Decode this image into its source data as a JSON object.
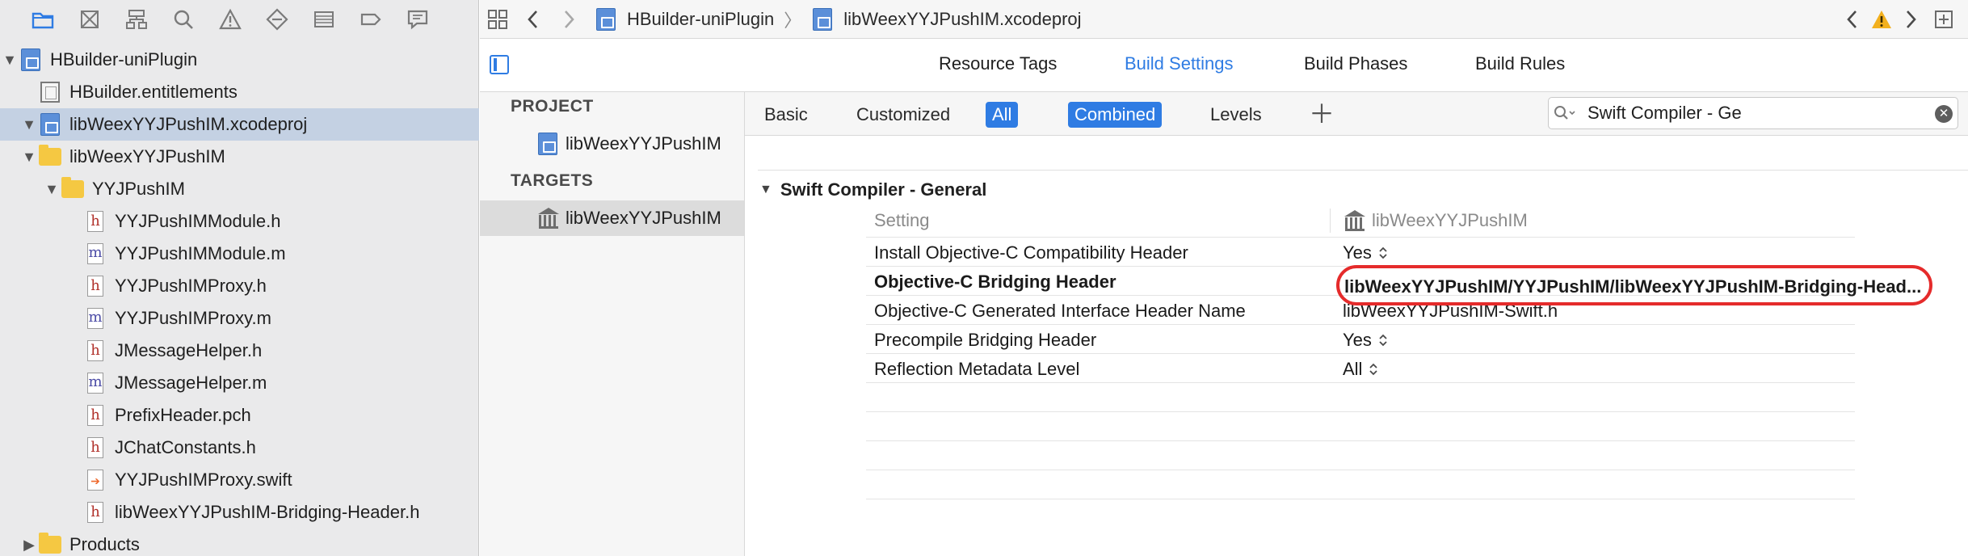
{
  "navigator": {
    "toolbar_icons": [
      "folder-icon",
      "source-control-icon",
      "hierarchy-icon",
      "search-icon",
      "warning-icon",
      "test-icon",
      "debug-icon",
      "breakpoint-icon",
      "report-icon"
    ],
    "tree": [
      {
        "label": "HBuilder-uniPlugin",
        "icon": "project-icon",
        "depth": 0,
        "disclosure": "▼"
      },
      {
        "label": "HBuilder.entitlements",
        "icon": "entitlements-icon",
        "depth": 1,
        "disclosure": ""
      },
      {
        "label": "libWeexYYJPushIM.xcodeproj",
        "icon": "project-icon",
        "depth": 1,
        "disclosure": "▼",
        "selected": true
      },
      {
        "label": "libWeexYYJPushIM",
        "icon": "folder-icon",
        "depth": 2,
        "disclosure": "▼"
      },
      {
        "label": "YYJPushIM",
        "icon": "folder-icon",
        "depth": 3,
        "disclosure": "▼"
      },
      {
        "label": "YYJPushIMModule.h",
        "icon": "h",
        "depth": 4,
        "disclosure": ""
      },
      {
        "label": "YYJPushIMModule.m",
        "icon": "m",
        "depth": 4,
        "disclosure": ""
      },
      {
        "label": "YYJPushIMProxy.h",
        "icon": "h",
        "depth": 4,
        "disclosure": ""
      },
      {
        "label": "YYJPushIMProxy.m",
        "icon": "m",
        "depth": 4,
        "disclosure": ""
      },
      {
        "label": "JMessageHelper.h",
        "icon": "h",
        "depth": 4,
        "disclosure": ""
      },
      {
        "label": "JMessageHelper.m",
        "icon": "m",
        "depth": 4,
        "disclosure": ""
      },
      {
        "label": "PrefixHeader.pch",
        "icon": "h",
        "depth": 4,
        "disclosure": ""
      },
      {
        "label": "JChatConstants.h",
        "icon": "h",
        "depth": 4,
        "disclosure": ""
      },
      {
        "label": "YYJPushIMProxy.swift",
        "icon": "swift",
        "depth": 4,
        "disclosure": ""
      },
      {
        "label": "libWeexYYJPushIM-Bridging-Header.h",
        "icon": "h",
        "depth": 4,
        "disclosure": ""
      },
      {
        "label": "Products",
        "icon": "folder-icon",
        "depth": 2,
        "disclosure": "▶"
      }
    ]
  },
  "jump_bar": {
    "project": "HBuilder-uniPlugin",
    "file": "libWeexYYJPushIM.xcodeproj",
    "separator": "〉"
  },
  "tabs": [
    {
      "label": "Resource Tags",
      "active": false
    },
    {
      "label": "Build Settings",
      "active": true
    },
    {
      "label": "Build Phases",
      "active": false
    },
    {
      "label": "Build Rules",
      "active": false
    }
  ],
  "targets_panel": {
    "project_header": "PROJECT",
    "project_item": "libWeexYYJPushIM",
    "targets_header": "TARGETS",
    "target_item": "libWeexYYJPushIM"
  },
  "filters": {
    "basic": "Basic",
    "customized": "Customized",
    "all": "All",
    "combined": "Combined",
    "levels": "Levels"
  },
  "search": {
    "value": "Swift Compiler - Ge"
  },
  "group": {
    "title": "Swift Compiler - General",
    "header_setting": "Setting",
    "header_target": "libWeexYYJPushIM",
    "rows": [
      {
        "name": "Install Objective-C Compatibility Header",
        "value": "Yes",
        "stepper": true,
        "bold": false
      },
      {
        "name": "Objective-C Bridging Header",
        "value": "",
        "stepper": false,
        "bold": true
      },
      {
        "name": "Objective-C Generated Interface Header Name",
        "value": "libWeexYYJPushIM-Swift.h",
        "stepper": false,
        "bold": false
      },
      {
        "name": "Precompile Bridging Header",
        "value": "Yes",
        "stepper": true,
        "bold": false
      },
      {
        "name": "Reflection Metadata Level",
        "value": "All",
        "stepper": true,
        "bold": false
      }
    ],
    "bridging_value": "libWeexYYJPushIM/YYJPushIM/libWeexYYJPushIM-Bridging-Head..."
  },
  "colors": {
    "accent": "#2f7ce3",
    "highlight_ring": "#e52b2b",
    "selection": "#c4d1e3"
  }
}
